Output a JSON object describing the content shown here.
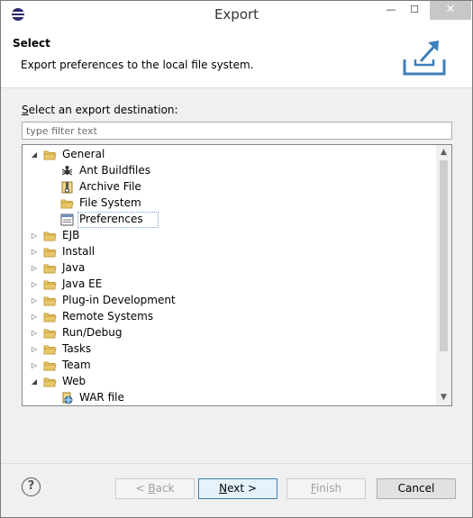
{
  "window": {
    "title": "Export",
    "minimize_glyph": "—",
    "maximize_glyph": "☐",
    "close_glyph": "✕"
  },
  "header": {
    "title": "Select",
    "description": "Export preferences to the local file system."
  },
  "destination": {
    "label_underlined": "S",
    "label_rest": "elect an export destination:",
    "filter_placeholder": "type filter text"
  },
  "tree": {
    "items": [
      {
        "label": "General",
        "level": 0,
        "expanded": true,
        "icon": "folder-icon"
      },
      {
        "label": "Ant Buildfiles",
        "level": 1,
        "icon": "ant-icon"
      },
      {
        "label": "Archive File",
        "level": 1,
        "icon": "archive-icon"
      },
      {
        "label": "File System",
        "level": 1,
        "icon": "folder-icon"
      },
      {
        "label": "Preferences",
        "level": 1,
        "icon": "preferences-icon",
        "selected": true
      },
      {
        "label": "EJB",
        "level": 0,
        "expanded": false,
        "icon": "folder-icon"
      },
      {
        "label": "Install",
        "level": 0,
        "expanded": false,
        "icon": "folder-icon"
      },
      {
        "label": "Java",
        "level": 0,
        "expanded": false,
        "icon": "folder-icon"
      },
      {
        "label": "Java EE",
        "level": 0,
        "expanded": false,
        "icon": "folder-icon"
      },
      {
        "label": "Plug-in Development",
        "level": 0,
        "expanded": false,
        "icon": "folder-icon"
      },
      {
        "label": "Remote Systems",
        "level": 0,
        "expanded": false,
        "icon": "folder-icon"
      },
      {
        "label": "Run/Debug",
        "level": 0,
        "expanded": false,
        "icon": "folder-icon"
      },
      {
        "label": "Tasks",
        "level": 0,
        "expanded": false,
        "icon": "folder-icon"
      },
      {
        "label": "Team",
        "level": 0,
        "expanded": false,
        "icon": "folder-icon"
      },
      {
        "label": "Web",
        "level": 0,
        "expanded": true,
        "icon": "folder-icon"
      },
      {
        "label": "WAR file",
        "level": 1,
        "icon": "war-file-icon"
      }
    ]
  },
  "footer": {
    "help_glyph": "?",
    "back_mnemonic": "B",
    "back_prefix": "< ",
    "back_rest": "ack",
    "next_mnemonic": "N",
    "next_rest": "ext >",
    "finish_mnemonic": "F",
    "finish_rest": "inish",
    "cancel_label": "Cancel"
  },
  "colors": {
    "folder": "#e8c66a",
    "folder_dark": "#c9a13e",
    "selection_border": "#7da2ce",
    "default_button_border": "#3c7fb1",
    "export_icon": "#3d7fb8"
  }
}
